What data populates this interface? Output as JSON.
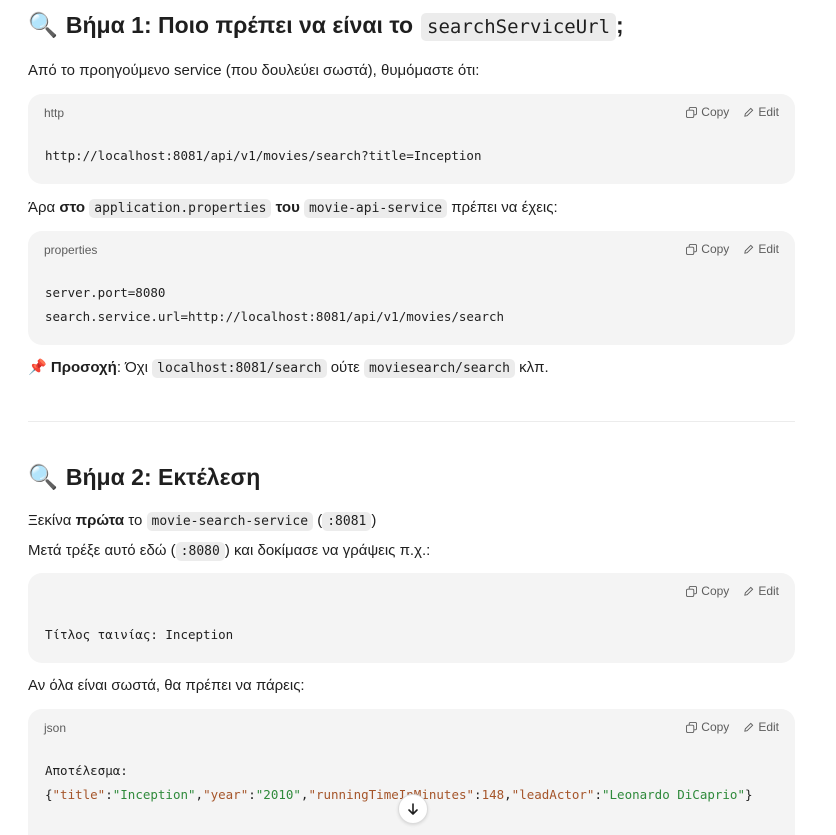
{
  "step1": {
    "icon": "🔍",
    "title": "Βήμα 1: Ποιο πρέπει να είναι το",
    "code": "searchServiceUrl",
    "suffix": ";"
  },
  "p1": "Από το προηγούμενο service (που δουλεύει σωστά), θυμόμαστε ότι:",
  "block1": {
    "lang": "http",
    "copy_label": "Copy",
    "edit_label": "Edit",
    "lines": [
      "http://localhost:8081/api/v1/movies/search?title=Inception"
    ]
  },
  "p2": {
    "t1": "Άρα ",
    "b1": "στο",
    "c1": "application.properties",
    "b2": "του",
    "c2": "movie-api-service",
    "t2": " πρέπει να έχεις:"
  },
  "block2": {
    "lang": "properties",
    "copy_label": "Copy",
    "edit_label": "Edit",
    "lines": [
      "server.port=8080",
      "search.service.url=http://localhost:8081/api/v1/movies/search"
    ]
  },
  "note": {
    "icon": "📌",
    "label": "Προσοχή",
    "colon": ":",
    "t1": " Όχι ",
    "c1": "localhost:8081/search",
    "t2": " ούτε ",
    "c2": "moviesearch/search",
    "t3": " κλπ."
  },
  "step2": {
    "icon": "🔍",
    "title": "Βήμα 2: Εκτέλεση"
  },
  "p3": {
    "t1": "Ξεκίνα ",
    "b1": "πρώτα",
    "t2": " το ",
    "c1": "movie-search-service",
    "t3": " (",
    "c2": ":8081",
    "t4": ")"
  },
  "p4": {
    "t1": "Μετά τρέξε αυτό εδώ (",
    "c1": ":8080",
    "t2": ") και δοκίμασε να γράψεις π.χ.:"
  },
  "block3": {
    "copy_label": "Copy",
    "edit_label": "Edit",
    "lines": [
      "Τίτλος ταινίας: Inception"
    ]
  },
  "p5": "Αν όλα είναι σωστά, θα πρέπει να πάρεις:",
  "block4": {
    "lang": "json",
    "copy_label": "Copy",
    "edit_label": "Edit",
    "line1": "Αποτέλεσμα:",
    "json": {
      "open": "{",
      "k1": "\"title\"",
      "v1": "\"Inception\"",
      "k2": "\"year\"",
      "v2": "\"2010\"",
      "k3": "\"runningTimeInMinutes\"",
      "v3": "148",
      "k4": "\"leadActor\"",
      "v4": "\"Leonardo DiCaprio\"",
      "close": "}"
    }
  },
  "scroll_icon": "arrow-down-icon"
}
